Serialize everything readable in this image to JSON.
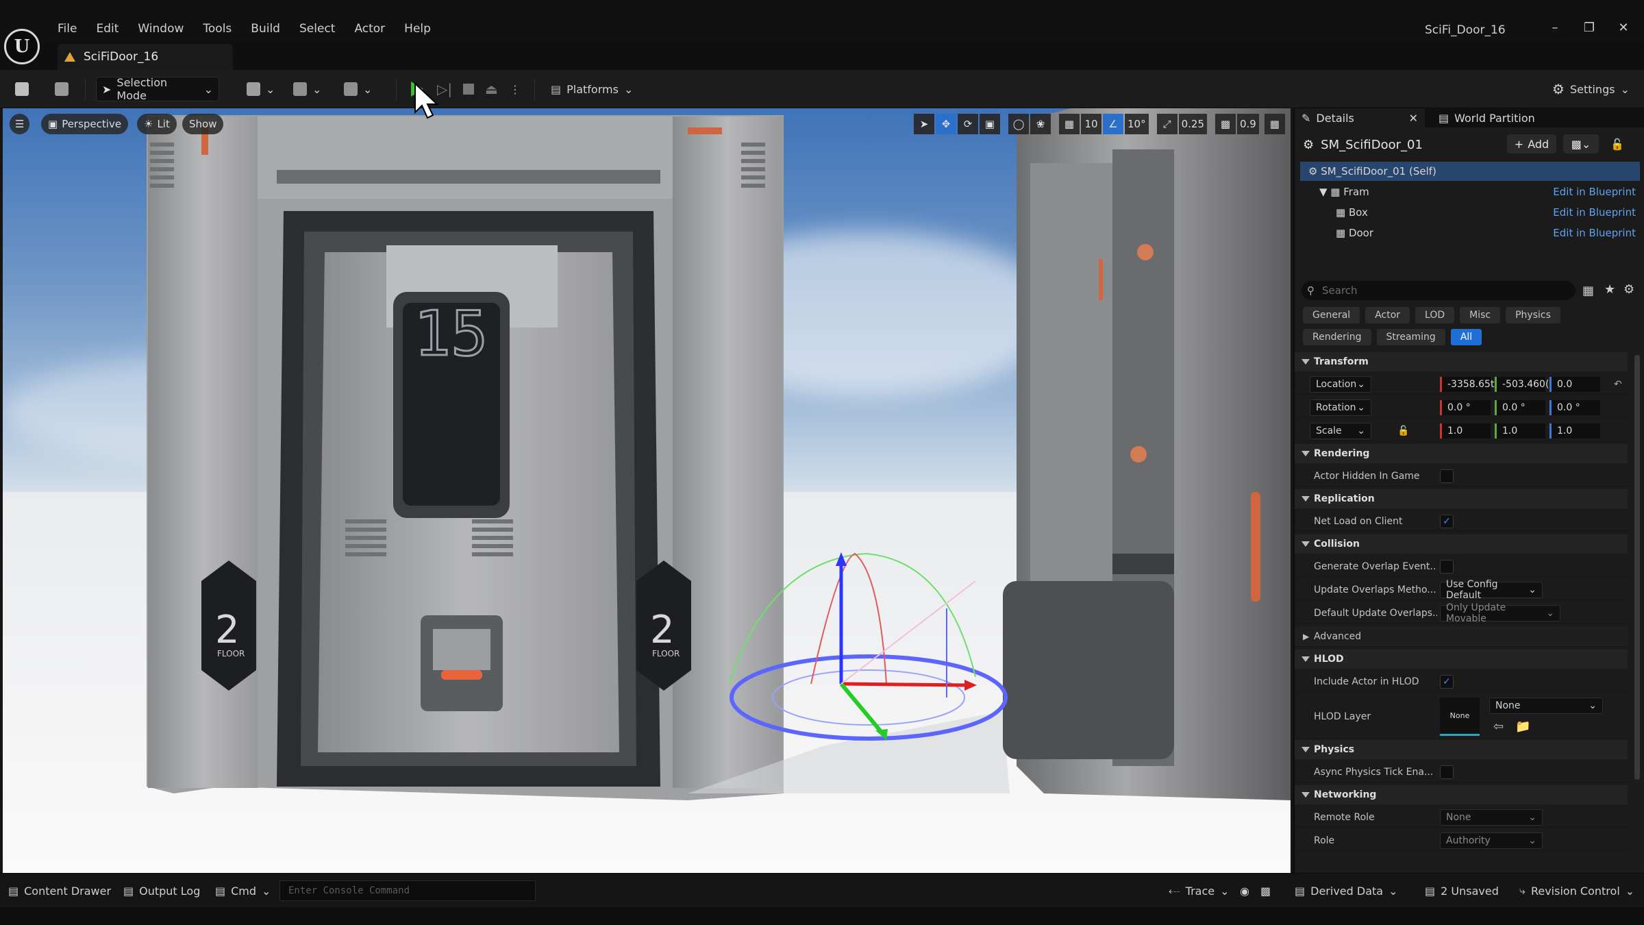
{
  "app": {
    "window_title": "SciFi_Door_16",
    "tab_title": "SciFiDoor_16",
    "logo_glyph": "U",
    "menu": [
      "File",
      "Edit",
      "Window",
      "Tools",
      "Build",
      "Select",
      "Actor",
      "Help"
    ]
  },
  "toolbar": {
    "mode": "Selection Mode",
    "platforms": "Platforms",
    "settings": "Settings"
  },
  "viewport": {
    "view": "Perspective",
    "lighting": "Lit",
    "show": "Show",
    "grid_snap": "10",
    "rotation_snap": "10°",
    "scale_snap": "0.25",
    "camera_speed": "0.9",
    "door_number": "15",
    "floor_number": "2",
    "floor_label": "FLOOR"
  },
  "details": {
    "tab_details": "Details",
    "tab_world_partition": "World Partition",
    "actor_name": "SM_ScifiDoor_01",
    "add_label": "Add",
    "components": [
      {
        "name": "SM_ScifiDoor_01 (Self)",
        "link": ""
      },
      {
        "name": "Fram",
        "link": "Edit in Blueprint"
      },
      {
        "name": "Box",
        "link": "Edit in Blueprint"
      },
      {
        "name": "Door",
        "link": "Edit in Blueprint"
      }
    ],
    "search_placeholder": "Search",
    "filters_row1": [
      "General",
      "Actor",
      "LOD",
      "Misc",
      "Physics"
    ],
    "filters_row2": [
      "Rendering",
      "Streaming",
      "All"
    ],
    "transform": {
      "title": "Transform",
      "location_label": "Location",
      "location": [
        "-3358.65t",
        "-503.460(",
        "0.0"
      ],
      "rotation_label": "Rotation",
      "rotation": [
        "0.0 °",
        "0.0 °",
        "0.0 °"
      ],
      "scale_label": "Scale",
      "scale": [
        "1.0",
        "1.0",
        "1.0"
      ]
    },
    "rendering": {
      "title": "Rendering",
      "actor_hidden": "Actor Hidden In Game"
    },
    "replication": {
      "title": "Replication",
      "net_load": "Net Load on Client"
    },
    "collision": {
      "title": "Collision",
      "gen_overlap": "Generate Overlap Event...",
      "update_method": "Update Overlaps Metho...",
      "update_method_value": "Use Config Default",
      "default_update": "Default Update Overlaps...",
      "default_update_value": "Only Update Movable"
    },
    "advanced": "Advanced",
    "hlod": {
      "title": "HLOD",
      "include": "Include Actor in HLOD",
      "layer": "HLOD Layer",
      "layer_thumb": "None",
      "layer_value": "None"
    },
    "physics": {
      "title": "Physics",
      "async_tick": "Async Physics Tick Ena..."
    },
    "networking": {
      "title": "Networking",
      "remote_role": "Remote Role",
      "remote_role_value": "None",
      "role": "Role",
      "role_value": "Authority"
    }
  },
  "statusbar": {
    "content_drawer": "Content Drawer",
    "output_log": "Output Log",
    "cmd": "Cmd",
    "console_placeholder": "Enter Console Command",
    "trace": "Trace",
    "derived_data": "Derived Data",
    "unsaved": "2 Unsaved",
    "revision_control": "Revision Control"
  }
}
